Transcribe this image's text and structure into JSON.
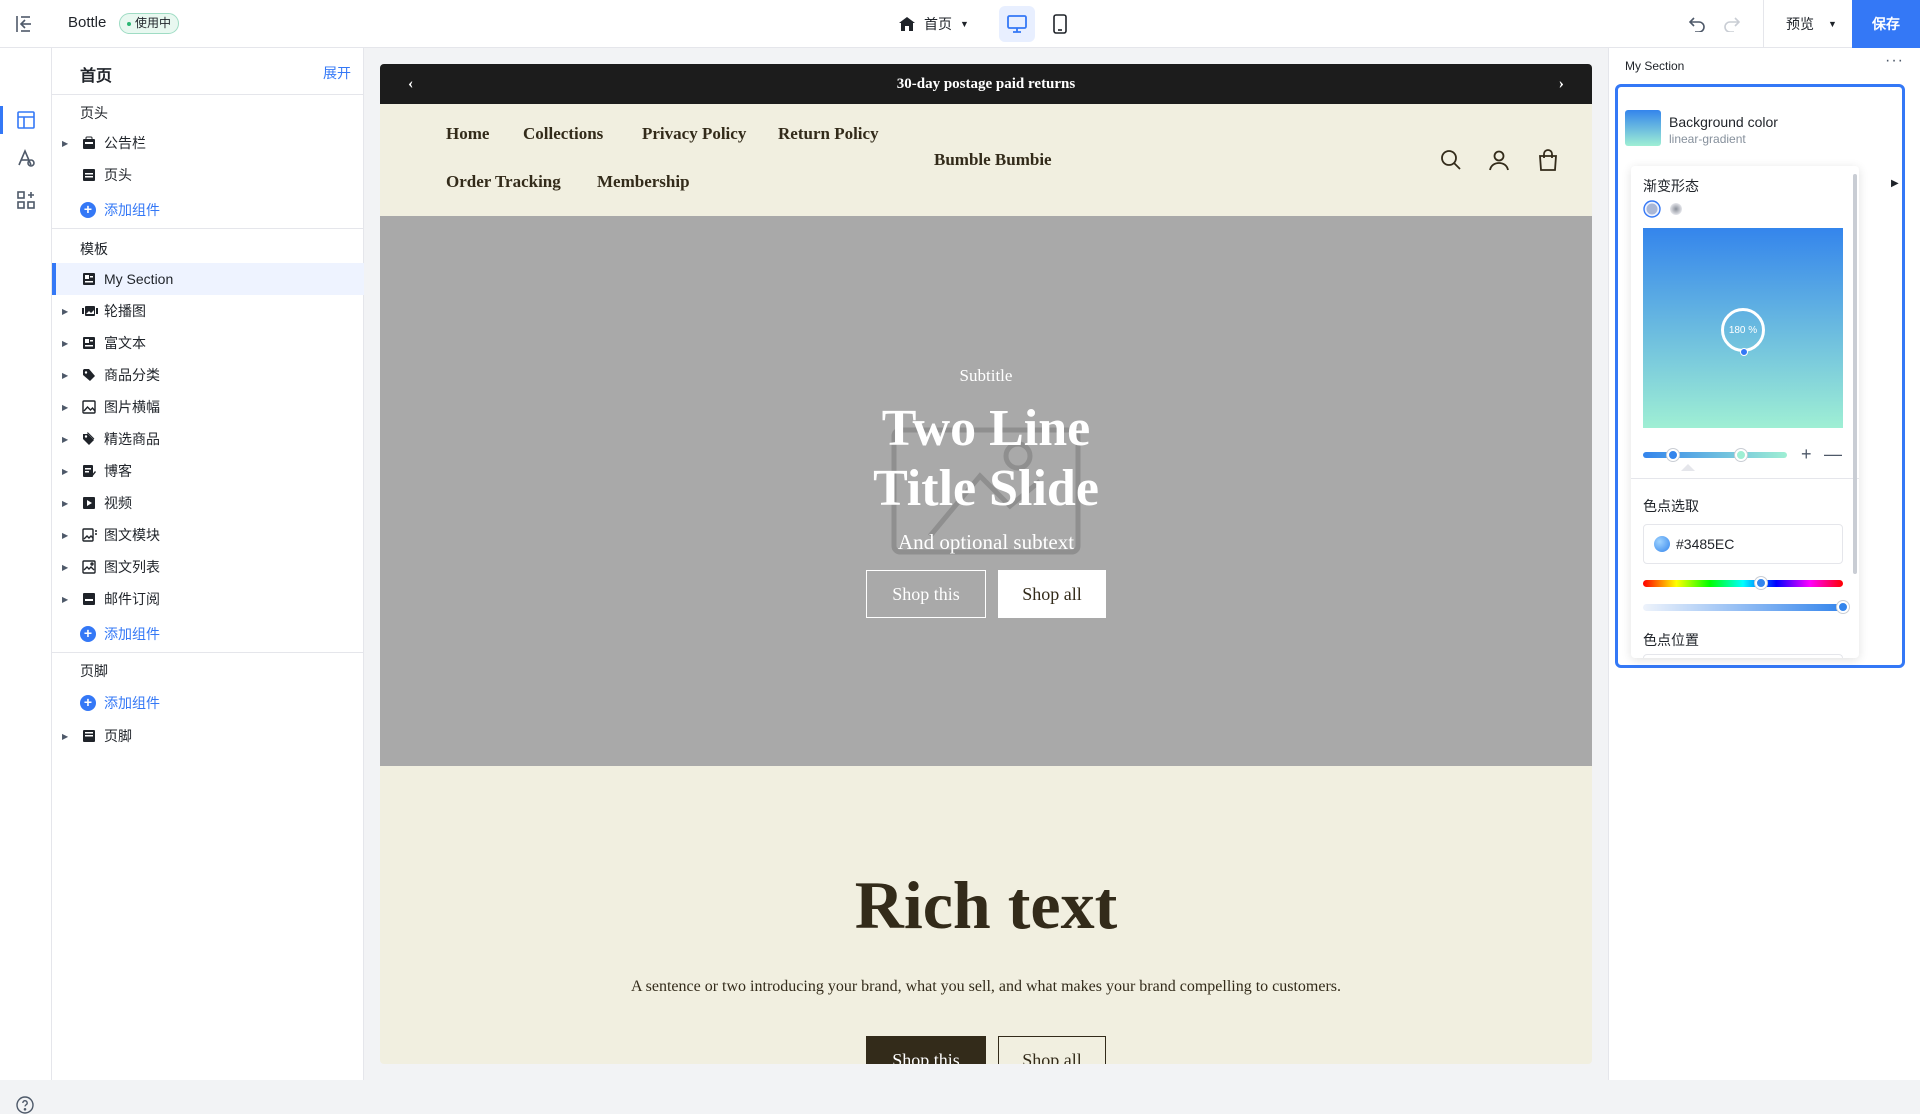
{
  "topbar": {
    "app_name": "Bottle",
    "status_badge": "使用中",
    "page_select": "首页",
    "preview_label": "预览",
    "save_label": "保存"
  },
  "tree": {
    "title": "首页",
    "expand_label": "展开",
    "header_group": "页头",
    "header_items": [
      "公告栏",
      "页头"
    ],
    "add_component": "添加组件",
    "template_group": "模板",
    "template_items": [
      "My Section",
      "轮播图",
      "富文本",
      "商品分类",
      "图片横幅",
      "精选商品",
      "博客",
      "视频",
      "图文模块",
      "图文列表",
      "邮件订阅"
    ],
    "footer_group": "页脚",
    "footer_items": [
      "页脚"
    ]
  },
  "canvas": {
    "announcement": "30-day postage paid returns",
    "nav": [
      "Home",
      "Collections",
      "Privacy Policy",
      "Return Policy",
      "Order Tracking",
      "Membership"
    ],
    "brand": "Bumble Bumbie",
    "hero": {
      "subtitle": "Subtitle",
      "title": "Two Line Title Slide",
      "subtext": "And optional subtext",
      "button_primary": "Shop this",
      "button_secondary": "Shop all"
    },
    "rich_text": {
      "title": "Rich text",
      "body": "A sentence or two introducing your brand, what you sell, and what makes your brand compelling to customers.",
      "button_primary": "Shop this",
      "button_secondary": "Shop all"
    }
  },
  "right_panel": {
    "title": "My Section",
    "background": {
      "label": "Background color",
      "value": "linear-gradient"
    },
    "gradient": {
      "shape_label": "渐变形态",
      "angle": "180 %",
      "color_pick_label": "色点选取",
      "hex": "#3485EC",
      "position_label": "色点位置",
      "start_color": "#3485EC",
      "end_color": "#9FEFD4"
    }
  },
  "colors": {
    "accent": "#3478F6",
    "announcement_bg": "#1C1C1C",
    "canvas_bg": "#F1EFE0",
    "hero_bg": "#A9A9A9",
    "brand_text": "#332B1A"
  }
}
